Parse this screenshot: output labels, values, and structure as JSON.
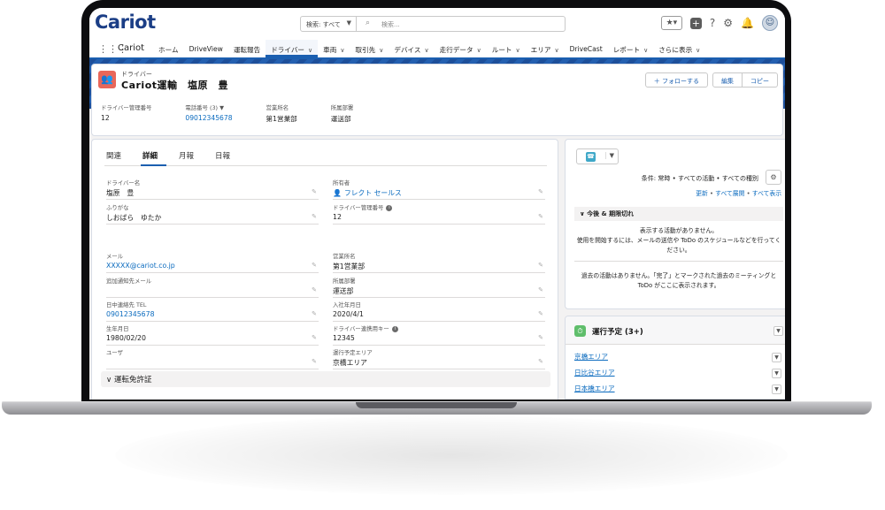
{
  "header": {
    "logo": "Cariot",
    "search_scope": "検索: すべて",
    "search_placeholder": "検索..."
  },
  "nav": {
    "app_name": "Cariot",
    "items": [
      {
        "label": "ホーム",
        "has_menu": false
      },
      {
        "label": "DriveView",
        "has_menu": false
      },
      {
        "label": "運転報告",
        "has_menu": false
      },
      {
        "label": "ドライバー",
        "has_menu": true
      },
      {
        "label": "車両",
        "has_menu": true
      },
      {
        "label": "取引先",
        "has_menu": true
      },
      {
        "label": "デバイス",
        "has_menu": true
      },
      {
        "label": "走行データ",
        "has_menu": true
      },
      {
        "label": "ルート",
        "has_menu": true
      },
      {
        "label": "エリア",
        "has_menu": true
      },
      {
        "label": "DriveCast",
        "has_menu": false
      },
      {
        "label": "レポート",
        "has_menu": true
      },
      {
        "label": "さらに表示",
        "has_menu": true
      }
    ],
    "active_index": 3
  },
  "record": {
    "type_label": "ドライバー",
    "title": "Cariot運輸　塩原　豊",
    "follow_button": "フォローする",
    "edit_button": "編集",
    "copy_button": "コピー",
    "highlights": [
      {
        "label": "ドライバー管理番号",
        "value": "12",
        "link": false,
        "dropdown": false
      },
      {
        "label": "電話番号 (3)",
        "value": "09012345678",
        "link": true,
        "dropdown": true
      },
      {
        "label": "営業所名",
        "value": "第1営業部",
        "link": false,
        "dropdown": false
      },
      {
        "label": "所属部署",
        "value": "運送部",
        "link": false,
        "dropdown": false
      }
    ]
  },
  "tabs": [
    "関連",
    "詳細",
    "月報",
    "日報"
  ],
  "active_tab": 1,
  "details": {
    "left": [
      {
        "label": "ドライバー名",
        "value": "塩原　豊",
        "link": false
      },
      {
        "label": "ふりがな",
        "value": "しおばら　ゆたか",
        "link": false
      },
      {
        "label": "メール",
        "value": "XXXXX@cariot.co.jp",
        "link": true
      },
      {
        "label": "追加通知先メール",
        "value": "",
        "link": false
      },
      {
        "label": "日中連絡先 TEL",
        "value": "09012345678",
        "link": true
      },
      {
        "label": "生年月日",
        "value": "1980/02/20",
        "link": false
      },
      {
        "label": "ユーザ",
        "value": "",
        "link": false
      }
    ],
    "right": [
      {
        "label": "所有者",
        "value": "フレクト セールス",
        "link": true,
        "info": false
      },
      {
        "label": "ドライバー管理番号",
        "value": "12",
        "link": false,
        "info": true
      },
      {
        "label": "営業所名",
        "value": "第1営業部",
        "link": false,
        "info": false
      },
      {
        "label": "所属部署",
        "value": "運送部",
        "link": false,
        "info": false
      },
      {
        "label": "入社年月日",
        "value": "2020/4/1",
        "link": false,
        "info": false
      },
      {
        "label": "ドライバー連携用キー",
        "value": "12345",
        "link": false,
        "info": true
      },
      {
        "label": "運行予定エリア",
        "value": "京橋エリア",
        "link": false,
        "info": false
      }
    ],
    "section_title": "運転免許証"
  },
  "activity": {
    "filter_text": "条件: 常時 • すべての活動 • すべての種別",
    "link_refresh": "更新",
    "link_expand": "すべて展開",
    "link_show_all": "すべて表示",
    "upcoming_title": "今後 & 期限切れ",
    "no_activity_1": "表示する活動がありません。",
    "no_activity_2": "使用を開始するには、メールの送信や ToDo のスケジュールなどを行ってください。",
    "past_message": "過去の活動はありません。「完了」とマークされた過去のミーティングと ToDo がここに表示されます。"
  },
  "schedule": {
    "title": "運行予定 (3+)",
    "rows": [
      "京橋エリア",
      "日比谷エリア",
      "日本橋エリア"
    ]
  }
}
